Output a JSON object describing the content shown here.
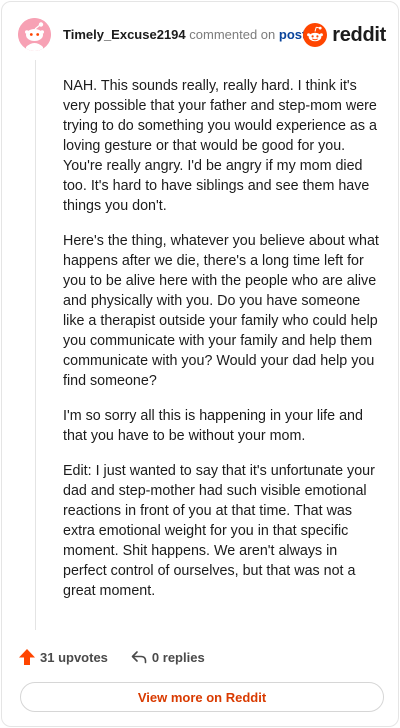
{
  "comment": {
    "author": "Timely_Excuse2194",
    "commented_on": "commented on",
    "post_link": "post",
    "avatar_icon": "snoo-avatar-icon",
    "paragraphs": [
      "NAH. This sounds really, really hard. I think it's very possible that your father and step-mom were trying to do something you would experience as a loving gesture or that would be good for you. You're really angry. I'd be angry if my mom died too. It's hard to have siblings and see them have things you don't.",
      "Here's the thing, whatever you believe about what happens after we die, there's a long time left for you to be alive here with the people who are alive and physically with you. Do you have someone like a therapist outside your family who could help you communicate with your family and help them communicate with you? Would your dad help you find someone?",
      "I'm so sorry all this is happening in your life and that you have to be without your mom.",
      "Edit: I just wanted to say that it's unfortunate your dad and step-mother had such visible emotional reactions in front of you at that time. That was extra emotional weight for you in that specific moment. Shit happens. We aren't always in perfect control of ourselves, but that was not a great moment."
    ],
    "upvotes": "31 upvotes",
    "replies": "0 replies"
  },
  "brand": {
    "name": "reddit",
    "color": "#ff4500",
    "icon": "reddit-logo-icon"
  },
  "footer": {
    "view_more": "View more on Reddit"
  },
  "colors": {
    "accent": "#d93a00",
    "upvote": "#ff4500",
    "link": "#0a449b"
  }
}
